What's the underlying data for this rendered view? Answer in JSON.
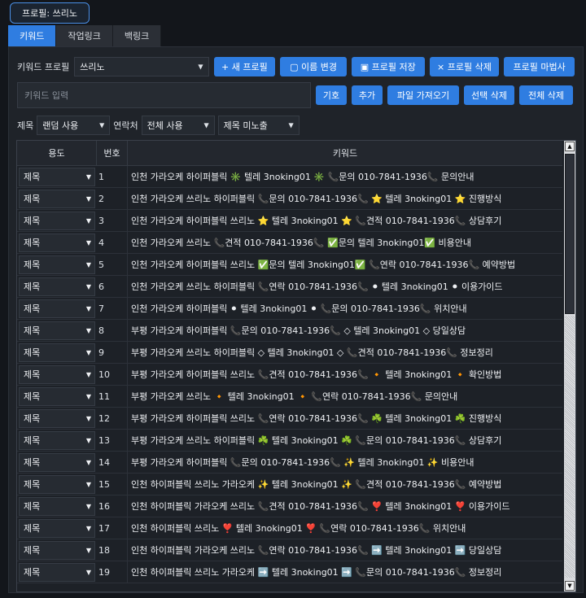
{
  "profile_tag": "프로필: 쓰리노",
  "tabs": [
    {
      "label": "키워드",
      "active": true
    },
    {
      "label": "작업링크",
      "active": false
    },
    {
      "label": "백링크",
      "active": false
    }
  ],
  "toolbar": {
    "profile_label": "키워드 프로필",
    "profile_value": "쓰리노",
    "new_profile": "+ 새 프로필",
    "rename": "▢ 이름 변경",
    "save_profile": "▣ 프로필 저장",
    "delete_profile": "× 프로필 삭제",
    "profile_wizard": "프로필 마법사"
  },
  "keyword_bar": {
    "placeholder": "키워드 입력",
    "symbol": "기호",
    "add": "추가",
    "import_file": "파일 가져오기",
    "delete_selected": "선택 삭제",
    "delete_all": "전체 삭제"
  },
  "filters": {
    "title_label": "제목",
    "title_value": "랜덤 사용",
    "contact_label": "연락처",
    "contact_value": "전체 사용",
    "title_expose_value": "제목 미노출"
  },
  "table": {
    "headers": [
      "용도",
      "번호",
      "키워드"
    ],
    "rows": [
      {
        "use": "제목",
        "num": "1",
        "kw": "인천 가라오케 하이퍼블릭 ✳️ 텔레 3noking01 ✳️ 📞문의 010-7841-1936📞 문의안내"
      },
      {
        "use": "제목",
        "num": "2",
        "kw": "인천 가라오케 쓰리노 하이퍼블릭 📞문의 010-7841-1936📞 ⭐ 텔레 3noking01 ⭐ 진행방식"
      },
      {
        "use": "제목",
        "num": "3",
        "kw": "인천 가라오케 하이퍼블릭 쓰리노 ⭐ 텔레 3noking01 ⭐ 📞견적 010-7841-1936📞 상담후기"
      },
      {
        "use": "제목",
        "num": "4",
        "kw": "인천 가라오케 쓰리노 📞견적 010-7841-1936📞 ✅문의 텔레 3noking01✅ 비용안내"
      },
      {
        "use": "제목",
        "num": "5",
        "kw": "인천 가라오케 하이퍼블릭 쓰리노 ✅문의 텔레 3noking01✅ 📞연락 010-7841-1936📞 예약방법"
      },
      {
        "use": "제목",
        "num": "6",
        "kw": "인천 가라오케 쓰리노 하이퍼블릭 📞연락 010-7841-1936📞 ⚫ 텔레 3noking01 ⚫ 이용가이드"
      },
      {
        "use": "제목",
        "num": "7",
        "kw": "인천 가라오케 하이퍼블릭 ⚫ 텔레 3noking01 ⚫ 📞문의 010-7841-1936📞 위치안내"
      },
      {
        "use": "제목",
        "num": "8",
        "kw": "부평 가라오케 하이퍼블릭 📞문의 010-7841-1936📞 ◇ 텔레 3noking01 ◇ 당일상담"
      },
      {
        "use": "제목",
        "num": "9",
        "kw": "부평 가라오케 쓰리노 하이퍼블릭 ◇ 텔레 3noking01 ◇ 📞견적 010-7841-1936📞 정보정리"
      },
      {
        "use": "제목",
        "num": "10",
        "kw": "부평 가라오케 하이퍼블릭 쓰리노 📞견적 010-7841-1936📞 🔸 텔레 3noking01 🔸 확인방법"
      },
      {
        "use": "제목",
        "num": "11",
        "kw": "부평 가라오케 쓰리노 🔸 텔레 3noking01 🔸 📞연락 010-7841-1936📞 문의안내"
      },
      {
        "use": "제목",
        "num": "12",
        "kw": "부평 가라오케 하이퍼블릭 쓰리노 📞연락 010-7841-1936📞 ☘️ 텔레 3noking01 ☘️ 진행방식"
      },
      {
        "use": "제목",
        "num": "13",
        "kw": "부평 가라오케 쓰리노 하이퍼블릭 ☘️ 텔레 3noking01 ☘️ 📞문의 010-7841-1936📞 상담후기"
      },
      {
        "use": "제목",
        "num": "14",
        "kw": "부평 가라오케 하이퍼블릭 📞문의 010-7841-1936📞 ✨ 텔레 3noking01 ✨ 비용안내"
      },
      {
        "use": "제목",
        "num": "15",
        "kw": "인천 하이퍼블릭 쓰리노 가라오케 ✨ 텔레 3noking01 ✨ 📞견적 010-7841-1936📞 예약방법"
      },
      {
        "use": "제목",
        "num": "16",
        "kw": "인천 하이퍼블릭 가라오케 쓰리노 📞견적 010-7841-1936📞 ❣️ 텔레 3noking01 ❣️ 이용가이드"
      },
      {
        "use": "제목",
        "num": "17",
        "kw": "인천 하이퍼블릭 쓰리노 ❣️ 텔레 3noking01 ❣️ 📞연락 010-7841-1936📞 위치안내"
      },
      {
        "use": "제목",
        "num": "18",
        "kw": "인천 하이퍼블릭 가라오케 쓰리노 📞연락 010-7841-1936📞 ➡️ 텔레 3noking01 ➡️ 당일상담"
      },
      {
        "use": "제목",
        "num": "19",
        "kw": "인천 하이퍼블릭 쓰리노 가라오케 ➡️ 텔레 3noking01 ➡️ 📞문의 010-7841-1936📞 정보정리"
      }
    ]
  },
  "colors": {
    "accent": "#2f7de1",
    "background": "#13161b",
    "panel": "#1f2329"
  }
}
